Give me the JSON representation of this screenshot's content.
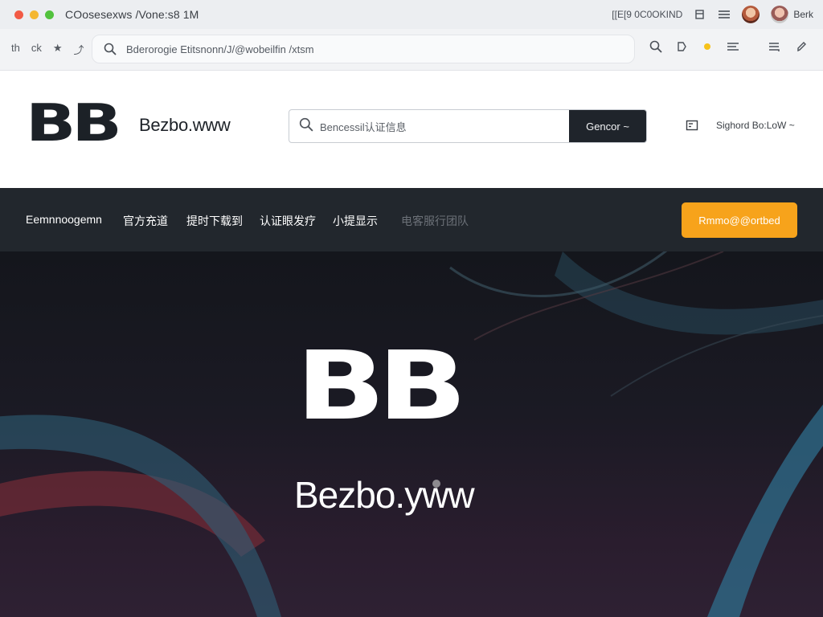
{
  "window": {
    "title": "COosesexws /Vone:s8 1M",
    "status_text": "[[E[9 0C0OKIND",
    "user_name": "Berk"
  },
  "browser": {
    "nav_buttons": [
      "th",
      "ck",
      "★",
      "⤴"
    ],
    "address": "Bderorogie Etitsnonn/J/@wobeilfin /xtsm"
  },
  "site": {
    "logo_mark": "BB",
    "logo_word": "Bezbo.www",
    "search_placeholder": "Bencessil认证信息",
    "search_button": "Gencor ~",
    "header_link": "Sighord Bo:LoW ~"
  },
  "nav": {
    "items": [
      {
        "label": "Eemnnoogemn",
        "muted": false
      },
      {
        "label": "官方充道",
        "muted": false
      },
      {
        "label": "提时下载到",
        "muted": false
      },
      {
        "label": "认证眼发疗",
        "muted": false
      },
      {
        "label": "小提显示",
        "muted": false
      },
      {
        "label": "电客服行团队",
        "muted": true
      }
    ],
    "cta": "Rmmo@@ortbed"
  },
  "hero": {
    "mark": "BB",
    "word": "Bezbo.yww"
  },
  "colors": {
    "accent": "#f7a31b",
    "nav_bg": "#22272d",
    "hero_bg": "#1b1a24"
  }
}
